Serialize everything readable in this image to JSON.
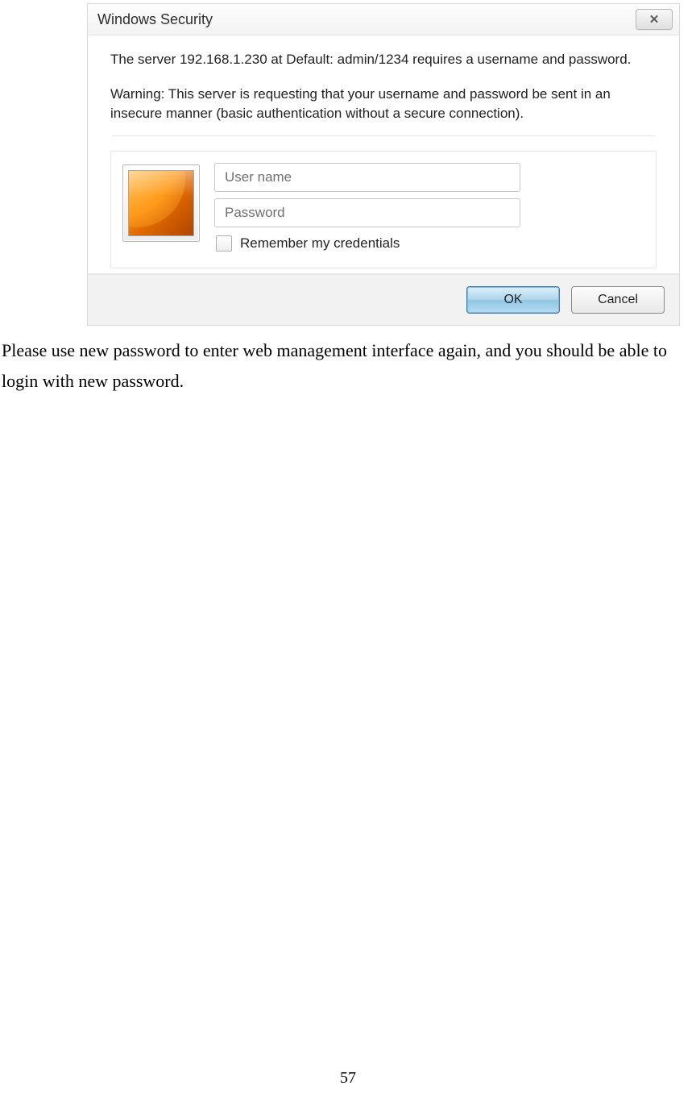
{
  "dialog": {
    "title": "Windows Security",
    "close_icon_glyph": "✕",
    "message": "The server 192.168.1.230 at Default: admin/1234 requires a username and password.",
    "warning": "Warning: This server is requesting that your username and password be sent in an insecure manner (basic authentication without a secure connection).",
    "username_placeholder": "User name",
    "password_placeholder": "Password",
    "remember_label": "Remember my credentials",
    "ok_label": "OK",
    "cancel_label": "Cancel"
  },
  "document": {
    "instruction": "Please use new password to enter web management interface again, and you should be able to login with new password.",
    "page_number": "57"
  }
}
